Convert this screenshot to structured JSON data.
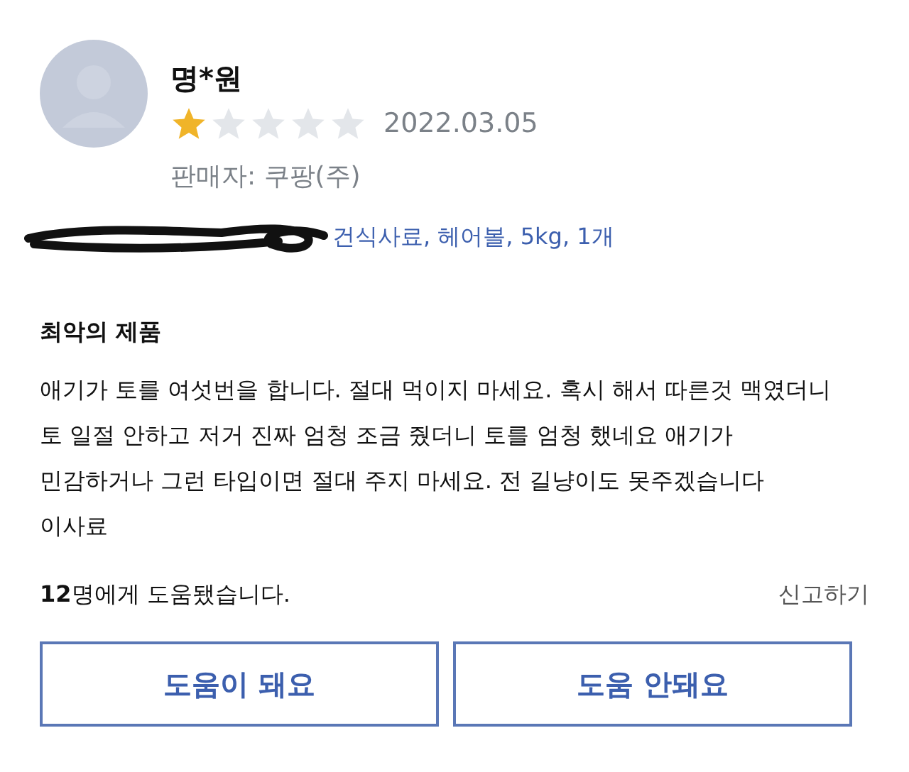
{
  "reviewer": {
    "name": "명*원",
    "stars": 1,
    "date": "2022.03.05",
    "seller": "판매자: 쿠팡(주)"
  },
  "product": {
    "name": "건식사료, 헤어볼, 5kg, 1개"
  },
  "review": {
    "title": "최악의 제품",
    "body": "애기가 토를 여섯번을 합니다. 절대 먹이지 마세요. 혹시 해서 따른것 맥였더니 토 일절 안하고 저거 진짜 엄청 조금 줬더니 토를 엄청 했네요 애기가 민감하거나 그런 타입이면 절대 주지 마세요. 전 길냥이도 못주겠습니다 이사료"
  },
  "helpful": {
    "count": "**12**명에게 도움됐습니다.",
    "report": "신고하기"
  },
  "buttons": [
    "도움이 돼요",
    "도움 안돼요"
  ]
}
